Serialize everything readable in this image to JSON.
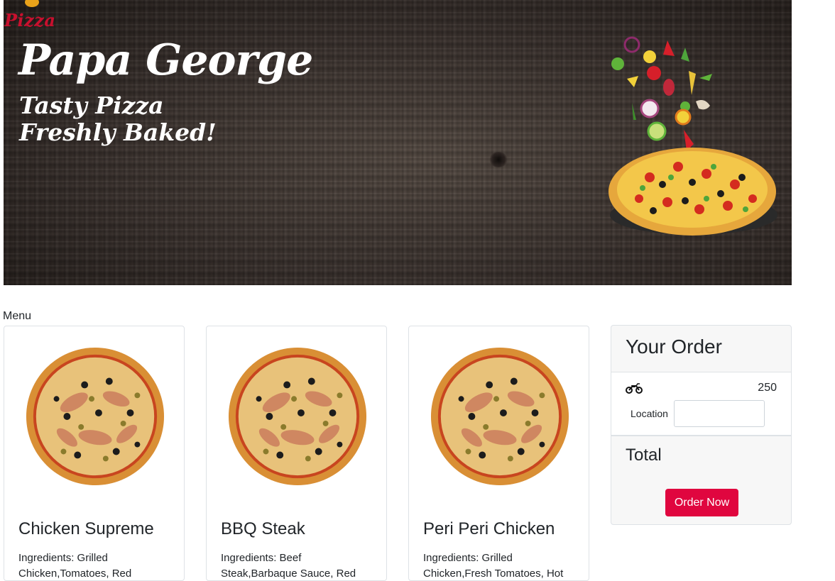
{
  "hero": {
    "logo_text": "Pizza",
    "brand": "Papa George",
    "tagline_line1": "Tasty Pizza",
    "tagline_line2": "Freshly Baked!"
  },
  "menu": {
    "label": "Menu",
    "items": [
      {
        "title": "Chicken Supreme",
        "ingredients": "Ingredients: Grilled Chicken,Tomatoes, Red"
      },
      {
        "title": "BBQ Steak",
        "ingredients": "Ingredients: Beef Steak,Barbaque Sauce, Red"
      },
      {
        "title": "Peri Peri Chicken",
        "ingredients": "Ingredients: Grilled Chicken,Fresh Tomatoes, Hot"
      }
    ]
  },
  "order": {
    "title": "Your Order",
    "delivery_icon": "motorcycle-icon",
    "delivery_amount": "250",
    "location_label": "Location",
    "location_value": "",
    "total_label": "Total",
    "order_button": "Order Now"
  },
  "colors": {
    "accent": "#e0063f",
    "logo_red": "#c8102e",
    "card_border": "#dee2e6"
  }
}
